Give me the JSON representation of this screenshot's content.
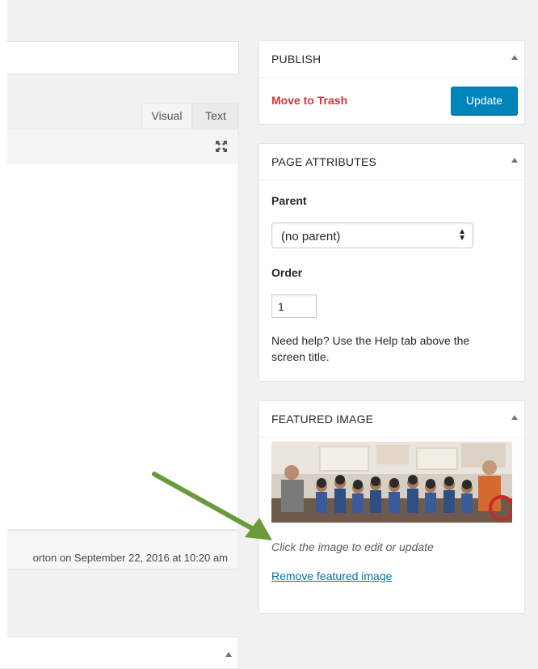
{
  "editor": {
    "tabs": [
      {
        "label": "Visual",
        "active": true
      },
      {
        "label": "Text",
        "active": false
      }
    ],
    "expand_icon": "fullscreen-icon",
    "status_text": "orton on September 22, 2016 at 10:20 am"
  },
  "publish": {
    "title": "PUBLISH",
    "trash_label": "Move to Trash",
    "update_label": "Update"
  },
  "page_attributes": {
    "title": "PAGE ATTRIBUTES",
    "parent_label": "Parent",
    "parent_value": "(no parent)",
    "order_label": "Order",
    "order_value": "1",
    "help_text": "Need help? Use the Help tab above the screen title."
  },
  "featured_image": {
    "title": "FEATURED IMAGE",
    "caption": "Click the image to edit or update",
    "remove_label": "Remove featured image"
  },
  "colors": {
    "primary": "#0085ba",
    "trash": "#dc3232",
    "link": "#0073aa",
    "arrow": "#6a9a3a"
  },
  "icons": {
    "collapse": "triangle-up-icon",
    "dropdown": "updown-arrows-icon",
    "annotation": "green-arrow-icon"
  }
}
